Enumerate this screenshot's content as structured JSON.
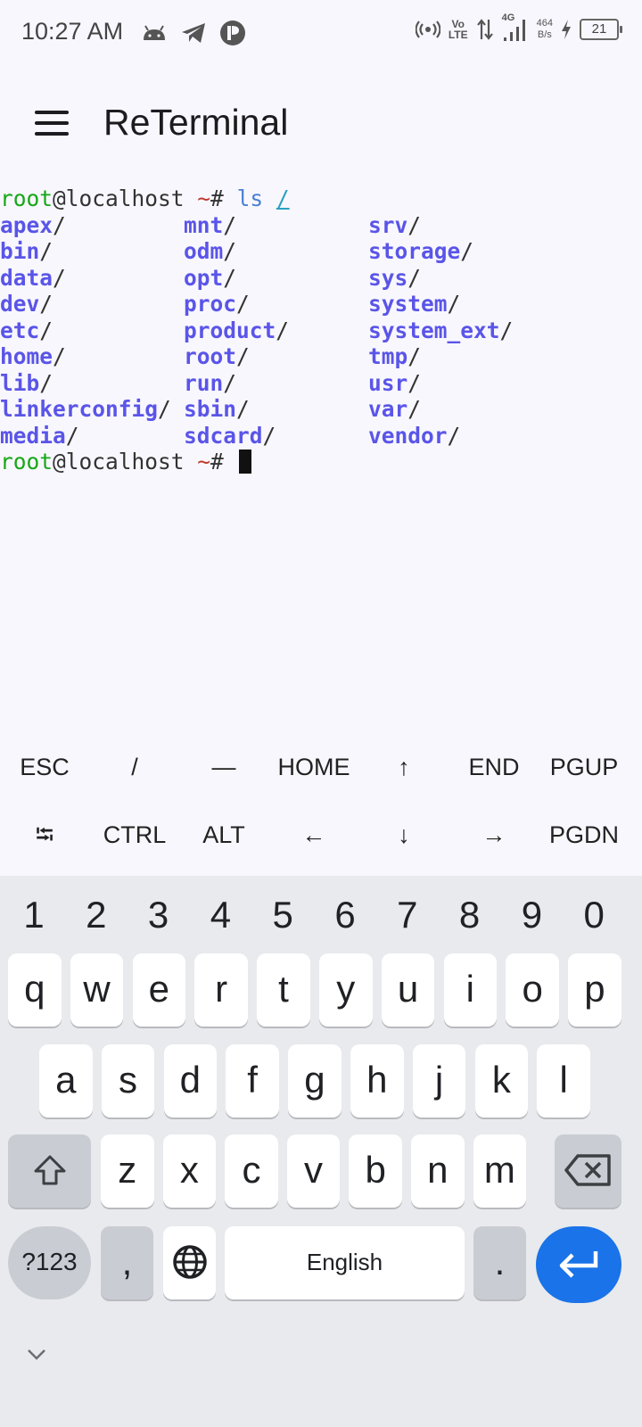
{
  "status_bar": {
    "time": "10:27 AM",
    "notification_icons": [
      "android-icon",
      "telegram-icon",
      "app-p-icon"
    ],
    "volte_line1": "Vo",
    "volte_line2": "LTE",
    "network": "4G",
    "speed_value": "464",
    "speed_unit": "B/s",
    "battery": "21"
  },
  "app_bar": {
    "title": "ReTerminal"
  },
  "terminal": {
    "prompt_user": "root",
    "prompt_host": "@localhost",
    "prompt_tilde": " ~",
    "prompt_hash": "# ",
    "command": "ls",
    "command_arg": "/",
    "ls_columns": [
      [
        "apex",
        "bin",
        "data",
        "dev",
        "etc",
        "home",
        "lib",
        "linkerconfig",
        "media"
      ],
      [
        "mnt",
        "odm",
        "opt",
        "proc",
        "product",
        "root",
        "run",
        "sbin",
        "sdcard"
      ],
      [
        "srv",
        "storage",
        "sys",
        "system",
        "system_ext",
        "tmp",
        "usr",
        "var",
        "vendor"
      ]
    ],
    "dir_suffix": "/"
  },
  "extra_keys": {
    "row1": [
      "ESC",
      "/",
      "—",
      "HOME",
      "↑",
      "END",
      "PGUP"
    ],
    "row2": [
      "⭾",
      "CTRL",
      "ALT",
      "←",
      "↓",
      "→",
      "PGDN"
    ]
  },
  "keyboard": {
    "numbers": [
      "1",
      "2",
      "3",
      "4",
      "5",
      "6",
      "7",
      "8",
      "9",
      "0"
    ],
    "row1": [
      "q",
      "w",
      "e",
      "r",
      "t",
      "y",
      "u",
      "i",
      "o",
      "p"
    ],
    "row2": [
      "a",
      "s",
      "d",
      "f",
      "g",
      "h",
      "j",
      "k",
      "l"
    ],
    "row3": [
      "z",
      "x",
      "c",
      "v",
      "b",
      "n",
      "m"
    ],
    "symbols_label": "?123",
    "comma": ",",
    "space_label": "English",
    "period": "."
  },
  "colors": {
    "accent_blue": "#1a73e8",
    "prompt_green": "#17a817",
    "dir_purple": "#5a55e8"
  }
}
